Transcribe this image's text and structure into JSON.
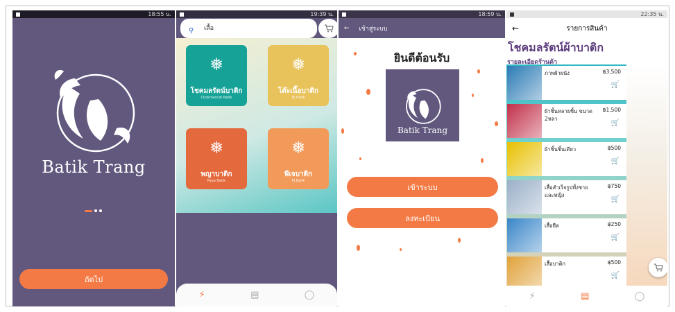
{
  "colors": {
    "purple": "#62587e",
    "orange": "#f47a45",
    "teal": "#5bc6c4",
    "title_purple": "#5c3b7c"
  },
  "screen1": {
    "status_time": "18:55 น.",
    "splash_label": "",
    "brand": "Batik Trang",
    "next_button": "ถัดไป"
  },
  "screen2": {
    "status_time": "19:39 น.",
    "search_value": "เสื้อ",
    "shops": [
      {
        "name": "โชคมลรัตน์บาติก",
        "sub": "Chokmonrat Batik",
        "color": "#16a297",
        "icon": "ornament-icon"
      },
      {
        "name": "โต๊ะเนื๊อบาติก",
        "sub": "To Batik",
        "color": "#e8c25a",
        "icon": "ornament-icon"
      },
      {
        "name": "พญาบาติก",
        "sub": "Paya Batik",
        "color": "#e4693c",
        "icon": "ornament-icon"
      },
      {
        "name": "พีเจบาติก",
        "sub": "PJ Batik",
        "color": "#f29a5a",
        "icon": "ornament-icon"
      }
    ],
    "nav_icons": [
      "bolt-icon",
      "store-icon",
      "user-icon"
    ]
  },
  "screen3": {
    "status_time": "18:59 น.",
    "appbar_title": "เข้าสู่ระบบ",
    "welcome": "ยินดีต้อนรับ",
    "logo_text": "Batik Trang",
    "login_button": "เข้าระบบ",
    "register_button": "ลงทะเบียน"
  },
  "screen4": {
    "status_time": "22:35 น.",
    "appbar_title": "รายการสินค้า",
    "shop_name": "โชคมลรัตน์ผ้าบาติก",
    "section": "รายละเอียดร้านค้า",
    "products": [
      {
        "name": "ภาพผ้าผนัง",
        "price": "฿3,500",
        "img": "#2b7bb5"
      },
      {
        "name": "ผ้าชิ้นหลายชิ้น ขนาด 2หลา",
        "price": "฿1,500",
        "img": "#c2304a"
      },
      {
        "name": "ผ้าชิ้นชิ้นเดียว",
        "price": "฿500",
        "img": "#e8c000"
      },
      {
        "name": "เสื้อสำเร็จรูปทั้งชาย และหญิง",
        "price": "฿750",
        "img": "#9bb0c8"
      },
      {
        "name": "เสื้อยืด",
        "price": "฿250",
        "img": "#3a86c8"
      },
      {
        "name": "เสื้อบาติก",
        "price": "฿500",
        "img": "#e0a23a"
      }
    ]
  }
}
